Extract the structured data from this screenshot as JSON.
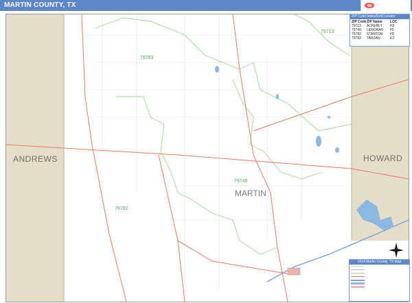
{
  "header": {
    "title": "MARTIN COUNTY, TX"
  },
  "map": {
    "neighbor_counties": [
      {
        "name": "ANDREWS",
        "key": "andrews"
      },
      {
        "name": "HOWARD",
        "key": "howard"
      }
    ],
    "county_name": "MARTIN",
    "zip_labels": [
      "79713",
      "79783",
      "79749",
      "79782"
    ],
    "colors": {
      "header": "#5b86c8",
      "neighbor_fill": "#e6ddc8",
      "highway": "#e07a5f",
      "zip_boundary": "#9fd39a",
      "road": "#c8c8c8",
      "water": "#8ab8e0"
    }
  },
  "zip_table": {
    "title": "ZIP Code Index/Grid Locator",
    "columns": [
      "ZIP Code",
      "ZIP Name",
      "LOC"
    ],
    "rows": [
      [
        "79713",
        "ACKERLY",
        "H2"
      ],
      [
        "79749",
        "LENORAH",
        "F5"
      ],
      [
        "79782",
        "STANTON",
        "F8"
      ],
      [
        "79783",
        "TARZAN",
        "E2"
      ]
    ]
  },
  "legend": {
    "title": "2014 Martin County, TX Map"
  },
  "icons": {
    "compass": "compass-rose-icon",
    "logo": "map-sales-logo-icon"
  }
}
